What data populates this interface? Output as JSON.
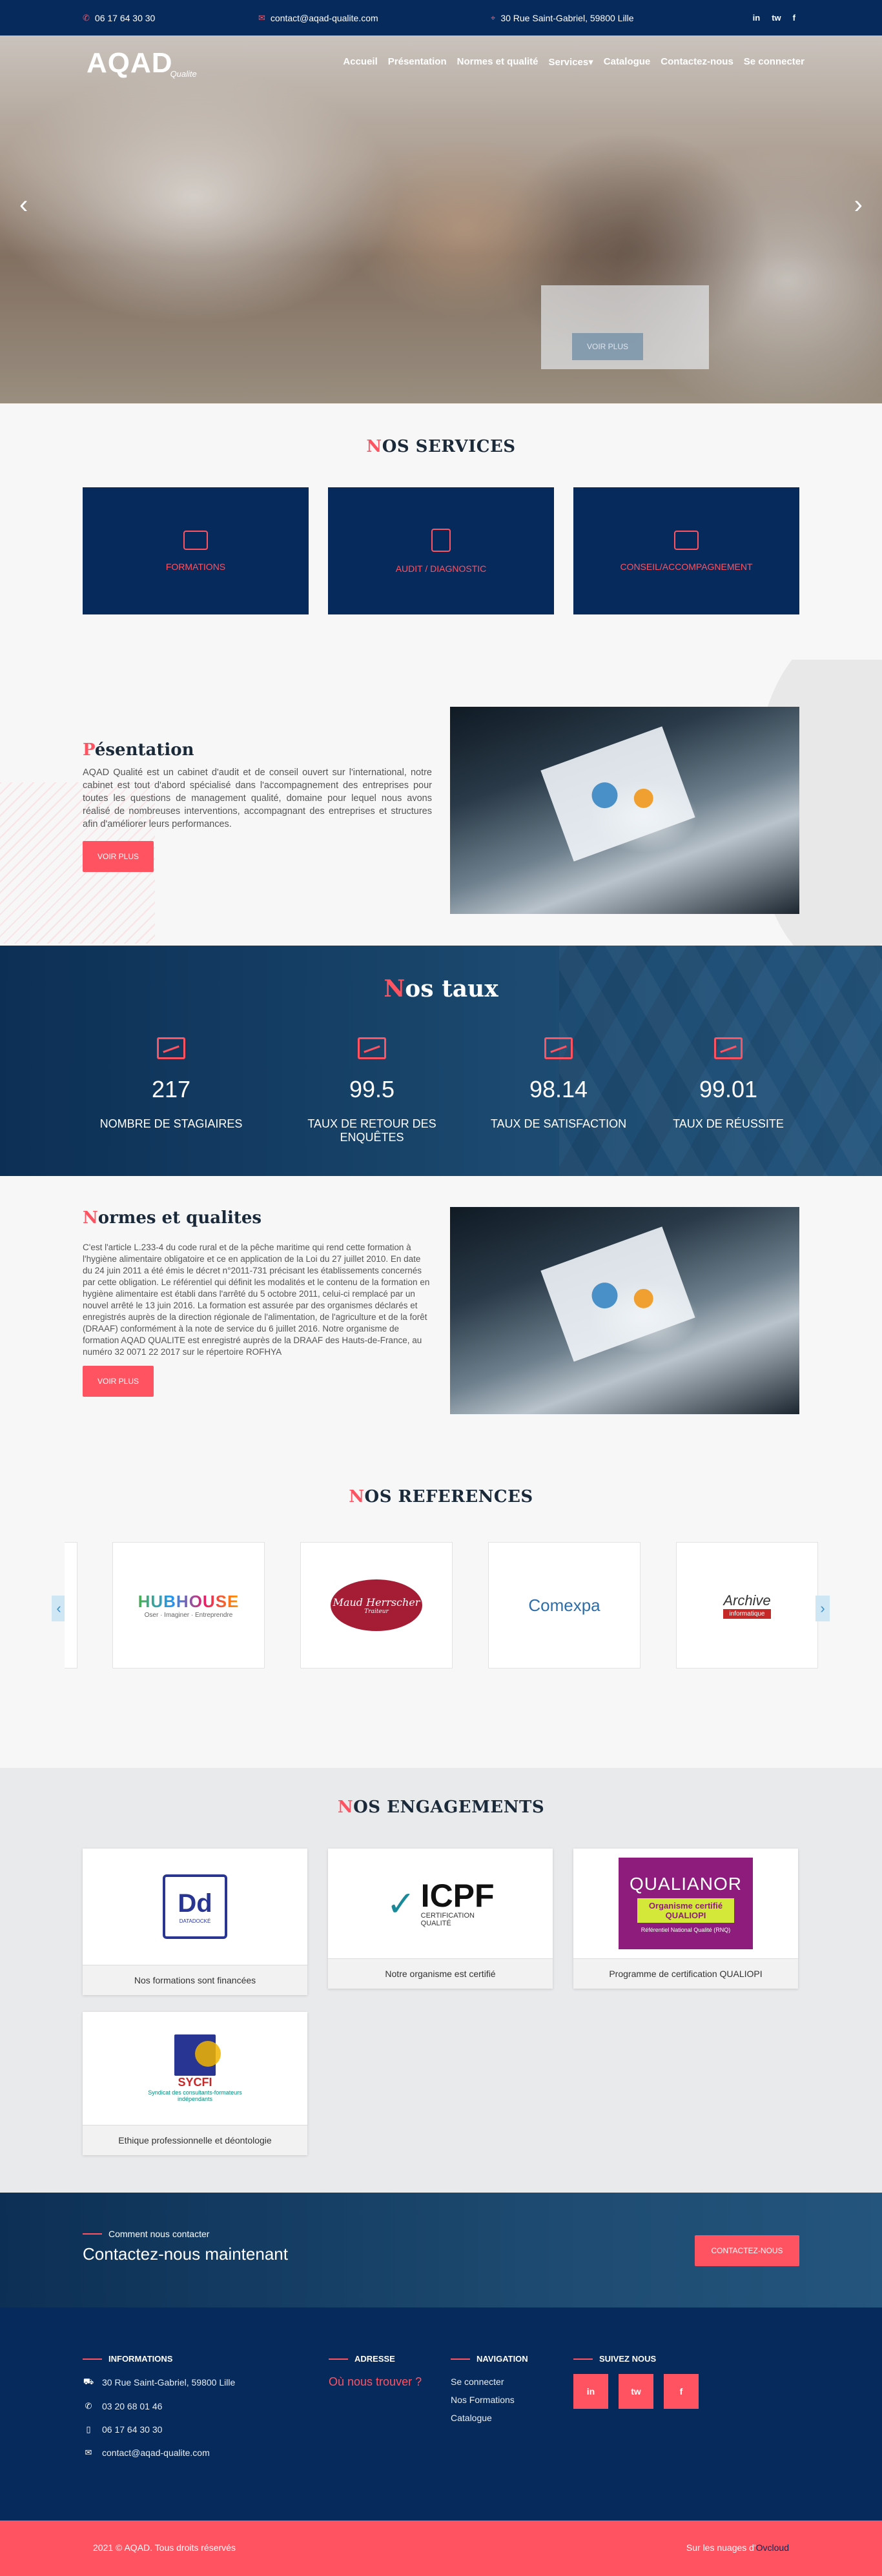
{
  "topbar": {
    "phone": "06 17 64 30 30",
    "email": "contact@aqad-qualite.com",
    "address": "30 Rue Saint-Gabriel, 59800 Lille",
    "socials": [
      "in",
      "tw",
      "f"
    ]
  },
  "logo": {
    "main": "AQAD",
    "sub": "Qualite"
  },
  "nav": [
    "Accueil",
    "Présentation",
    "Normes et qualité",
    "Services▾",
    "Catalogue",
    "Contactez-nous",
    "Se connecter"
  ],
  "hero": {
    "button": "VOIR PLUS"
  },
  "services": {
    "title_first": "N",
    "title_rest": "OS SERVICES",
    "items": [
      "FORMATIONS",
      "AUDIT / DIAGNOSTIC",
      "CONSEIL/ACCOMPAGNEMENT"
    ]
  },
  "presentation": {
    "title_first": "P",
    "title_rest": "ésentation",
    "text": "AQAD Qualité est un cabinet d'audit et de conseil ouvert sur l'international, notre cabinet est tout d'abord spécialisé dans l'accompagnement des entreprises pour toutes les questions de management qualité, domaine pour lequel nous avons réalisé de nombreuses interventions, accompagnant des entreprises et structures afin d'améliorer leurs performances.",
    "button": "VOIR PLUS"
  },
  "taux": {
    "title_first": "N",
    "title_rest": "os taux",
    "stats": [
      {
        "value": "217",
        "label": "NOMBRE DE STAGIAIRES"
      },
      {
        "value": "99.5",
        "label": "TAUX DE RETOUR DES ENQUÊTES"
      },
      {
        "value": "98.14",
        "label": "TAUX DE SATISFACTION"
      },
      {
        "value": "99.01",
        "label": "TAUX DE RÉUSSITE"
      }
    ]
  },
  "normes": {
    "title_first": "N",
    "title_rest": "ormes et qualites",
    "text": "C'est l'article L.233-4 du code rural et de la pêche maritime qui rend cette formation à l'hygiène alimentaire obligatoire et ce en application de la Loi du 27 juillet 2010. En date du 24 juin 2011 a été émis le décret n°2011-731 précisant les établissements concernés par cette obligation. Le référentiel qui définit les modalités et le contenu de la formation en hygiène alimentaire est établi dans l'arrêté du 5 octobre 2011, celui-ci remplacé par un nouvel arrêté le 13 juin 2016. La formation est assurée par des organismes déclarés et enregistrés auprès de la direction régionale de l'alimentation, de l'agriculture et de la forêt (DRAAF) conformément à la note de service du 6 juillet 2016. Notre organisme de formation AQAD QUALITE est enregistré auprès de la DRAAF des Hauts-de-France, au numéro 32 0071 22 2017 sur le répertoire ROFHYA",
    "button": "VOIR PLUS"
  },
  "references": {
    "title_first": "N",
    "title_rest": "OS REFERENCES",
    "logos": [
      {
        "name": "HUBHOUSE",
        "tag": "Oser · Imaginer · Entreprendre"
      },
      {
        "name": "Maud Herrscher",
        "tag": "Traiteur"
      },
      {
        "name": "Comexpa",
        "tag": ""
      },
      {
        "name": "Archive",
        "tag": "informatique"
      }
    ]
  },
  "engagements": {
    "title_first": "N",
    "title_rest": "OS ENGAGEMENTS",
    "cards": [
      {
        "logo": "DATADOCKÉ",
        "caption": "Nos formations sont financées"
      },
      {
        "logo": "ICPF",
        "logo_sub": "CERTIFICATION QUALITÉ",
        "caption": "Notre organisme est certifié"
      },
      {
        "logo": "QUALIANOR",
        "logo_sub": "Organisme certifié QUALIOPI",
        "logo_foot": "Référentiel National Qualité (RNQ)",
        "caption": "Programme de certification QUALIOPI"
      },
      {
        "logo": "SYCFI",
        "logo_sub": "Syndicat des consultants-formateurs indépendants",
        "caption": "Ethique professionnelle et déontologie"
      }
    ]
  },
  "contact": {
    "kicker": "Comment nous contacter",
    "title": "Contactez-nous maintenant",
    "button": "CONTACTEZ-NOUS"
  },
  "footer": {
    "info_title": "INFORMATIONS",
    "info": [
      "30 Rue Saint-Gabriel, 59800 Lille",
      "03 20 68 01 46",
      "06 17 64 30 30",
      "contact@aqad-qualite.com"
    ],
    "address_title": "ADRESSE",
    "address_link": "Où nous trouver ?",
    "nav_title": "NAVIGATION",
    "nav": [
      "Se connecter",
      "Nos Formations",
      "Catalogue"
    ],
    "follow_title": "SUIVEZ NOUS",
    "follow": [
      "in",
      "tw",
      "f"
    ]
  },
  "copyright": {
    "left": "2021 © AQAD. Tous droits réservés",
    "right_prefix": "Sur les nuages d'",
    "right_brand": "Ovcloud"
  },
  "colors": {
    "navy": "#062a5b",
    "accent": "#ff5361"
  }
}
